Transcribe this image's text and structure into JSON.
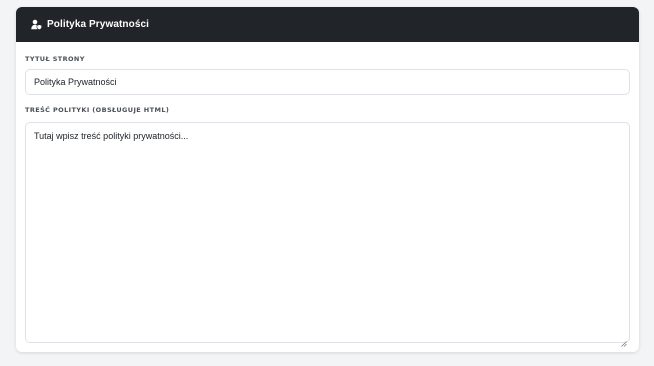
{
  "card": {
    "title": "Polityka Prywatności",
    "icon": "user-shield-icon"
  },
  "form": {
    "title_label": "Tytuł strony",
    "title_value": "Polityka Prywatności",
    "content_label": "Treść polityki (obsługuje HTML)",
    "content_placeholder": "Tutaj wpisz treść polityki prywatności..."
  },
  "colors": {
    "header_bg": "#212529",
    "page_bg": "#f3f4f6",
    "border": "#dee2e6"
  }
}
